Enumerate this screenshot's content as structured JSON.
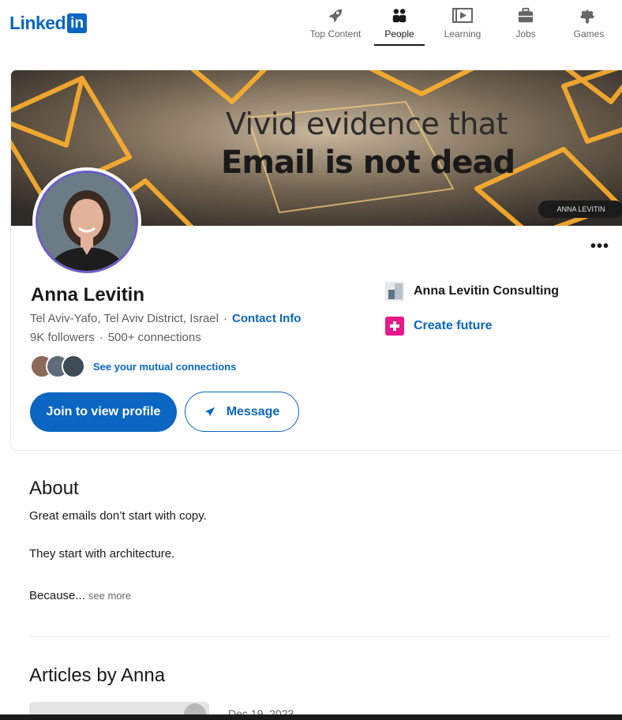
{
  "brand": {
    "logo_text": "Linked",
    "logo_box": "in",
    "color": "#0a66c2"
  },
  "nav": [
    {
      "label": "Top Content",
      "icon": "rocket-icon"
    },
    {
      "label": "People",
      "icon": "people-icon",
      "active": true
    },
    {
      "label": "Learning",
      "icon": "video-play-icon"
    },
    {
      "label": "Jobs",
      "icon": "briefcase-icon"
    },
    {
      "label": "Games",
      "icon": "puzzle-icon"
    }
  ],
  "banner": {
    "line1": "Vivid evidence that",
    "line2": "Email is not dead",
    "tag": "ANNA LEVITIN"
  },
  "profile": {
    "name": "Anna Levitin",
    "location": "Tel Aviv-Yafo, Tel Aviv District, Israel",
    "contact_info": "Contact Info",
    "followers": "9K followers",
    "connections": "500+ connections",
    "mutual_link": "See your mutual connections",
    "join_button": "Join to view profile",
    "message_button": "Message",
    "more_menu": "•••"
  },
  "experience": {
    "company": "Anna Levitin Consulting"
  },
  "education": {
    "school": "Create future"
  },
  "about": {
    "title": "About",
    "p1": "Great emails don’t start with copy.",
    "p2": "They start with architecture.",
    "p3": "Because...",
    "see_more": "see more"
  },
  "articles": {
    "title": "Articles by Anna",
    "first_date": "Dec 19, 2023"
  },
  "colors": {
    "accent": "#0a66c2",
    "ring": "#6a5fc7",
    "edu_logo": "#e8188a"
  }
}
